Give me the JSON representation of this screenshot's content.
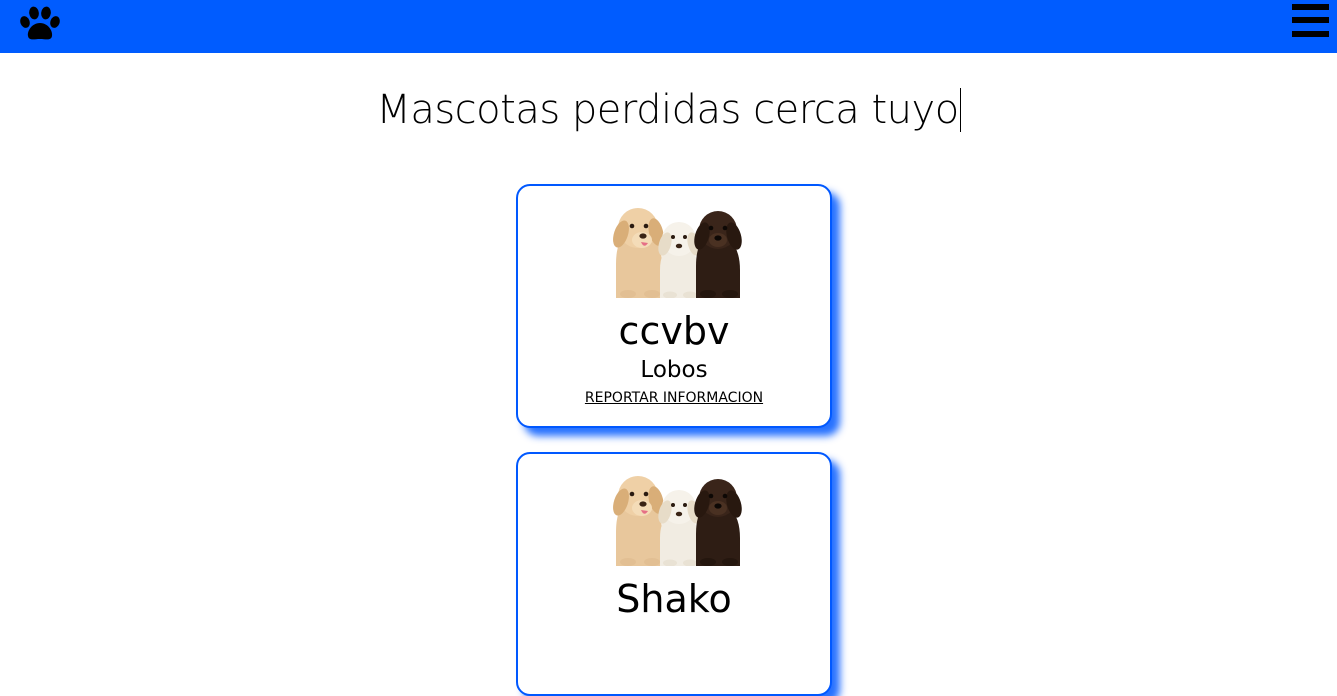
{
  "header": {
    "logo_icon": "paw-icon",
    "menu_icon": "hamburger-menu-icon",
    "background_color": "#005cff"
  },
  "main": {
    "title": "Mascotas perdidas cerca tuyo"
  },
  "pets": [
    {
      "name": "ccvbv",
      "location": "Lobos",
      "report_label": "REPORTAR INFORMACION"
    },
    {
      "name": "Shako",
      "location": "",
      "report_label": ""
    }
  ],
  "colors": {
    "accent": "#0058ff",
    "text": "#000000",
    "background": "#ffffff"
  }
}
